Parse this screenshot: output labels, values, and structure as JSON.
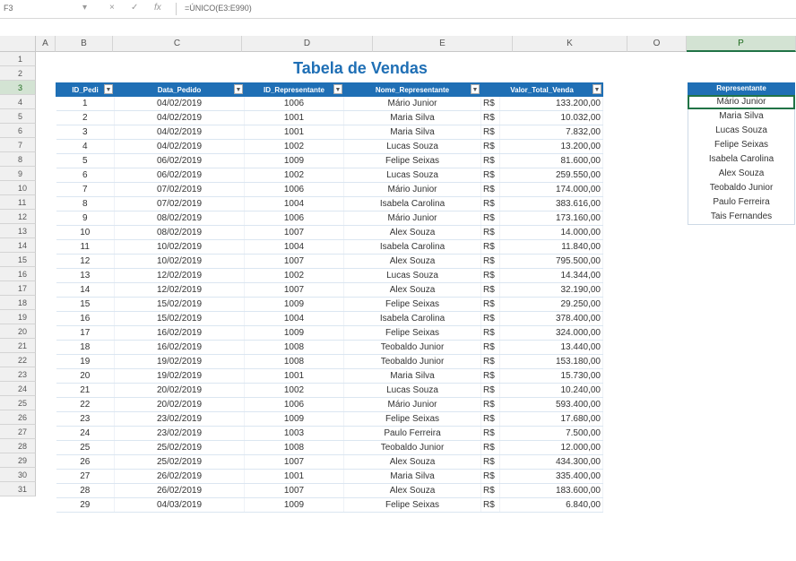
{
  "formula_bar": {
    "name_box": "F3",
    "fx": "fx",
    "formula": "=ÚNICO(E3:E990)"
  },
  "columns": [
    "A",
    "B",
    "C",
    "D",
    "E",
    "K",
    "O",
    "P"
  ],
  "rows": [
    "1",
    "2",
    "3",
    "4",
    "5",
    "6",
    "7",
    "8",
    "9",
    "10",
    "11",
    "12",
    "13",
    "14",
    "15",
    "16",
    "17",
    "18",
    "19",
    "20",
    "21",
    "22",
    "23",
    "24",
    "25",
    "26",
    "27",
    "28",
    "29",
    "30",
    "31"
  ],
  "title": "Tabela de Vendas",
  "table": {
    "headers": [
      "ID_Pedi",
      "Data_Pedido",
      "ID_Representante",
      "Nome_Representante",
      "Valor_Total_Venda"
    ],
    "currency": "R$",
    "rows": [
      [
        "1",
        "04/02/2019",
        "1006",
        "Mário Junior",
        "133.200,00"
      ],
      [
        "2",
        "04/02/2019",
        "1001",
        "Maria Silva",
        "10.032,00"
      ],
      [
        "3",
        "04/02/2019",
        "1001",
        "Maria Silva",
        "7.832,00"
      ],
      [
        "4",
        "04/02/2019",
        "1002",
        "Lucas Souza",
        "13.200,00"
      ],
      [
        "5",
        "06/02/2019",
        "1009",
        "Felipe Seixas",
        "81.600,00"
      ],
      [
        "6",
        "06/02/2019",
        "1002",
        "Lucas Souza",
        "259.550,00"
      ],
      [
        "7",
        "07/02/2019",
        "1006",
        "Mário Junior",
        "174.000,00"
      ],
      [
        "8",
        "07/02/2019",
        "1004",
        "Isabela Carolina",
        "383.616,00"
      ],
      [
        "9",
        "08/02/2019",
        "1006",
        "Mário Junior",
        "173.160,00"
      ],
      [
        "10",
        "08/02/2019",
        "1007",
        "Alex Souza",
        "14.000,00"
      ],
      [
        "11",
        "10/02/2019",
        "1004",
        "Isabela Carolina",
        "11.840,00"
      ],
      [
        "12",
        "10/02/2019",
        "1007",
        "Alex Souza",
        "795.500,00"
      ],
      [
        "13",
        "12/02/2019",
        "1002",
        "Lucas Souza",
        "14.344,00"
      ],
      [
        "14",
        "12/02/2019",
        "1007",
        "Alex Souza",
        "32.190,00"
      ],
      [
        "15",
        "15/02/2019",
        "1009",
        "Felipe Seixas",
        "29.250,00"
      ],
      [
        "16",
        "15/02/2019",
        "1004",
        "Isabela Carolina",
        "378.400,00"
      ],
      [
        "17",
        "16/02/2019",
        "1009",
        "Felipe Seixas",
        "324.000,00"
      ],
      [
        "18",
        "16/02/2019",
        "1008",
        "Teobaldo Junior",
        "13.440,00"
      ],
      [
        "19",
        "19/02/2019",
        "1008",
        "Teobaldo Junior",
        "153.180,00"
      ],
      [
        "20",
        "19/02/2019",
        "1001",
        "Maria Silva",
        "15.730,00"
      ],
      [
        "21",
        "20/02/2019",
        "1002",
        "Lucas Souza",
        "10.240,00"
      ],
      [
        "22",
        "20/02/2019",
        "1006",
        "Mário Junior",
        "593.400,00"
      ],
      [
        "23",
        "23/02/2019",
        "1009",
        "Felipe Seixas",
        "17.680,00"
      ],
      [
        "24",
        "23/02/2019",
        "1003",
        "Paulo Ferreira",
        "7.500,00"
      ],
      [
        "25",
        "25/02/2019",
        "1008",
        "Teobaldo Junior",
        "12.000,00"
      ],
      [
        "26",
        "25/02/2019",
        "1007",
        "Alex Souza",
        "434.300,00"
      ],
      [
        "27",
        "26/02/2019",
        "1001",
        "Maria Silva",
        "335.400,00"
      ],
      [
        "28",
        "26/02/2019",
        "1007",
        "Alex Souza",
        "183.600,00"
      ],
      [
        "29",
        "04/03/2019",
        "1009",
        "Felipe Seixas",
        "6.840,00"
      ]
    ]
  },
  "representantes": {
    "header": "Representante",
    "items": [
      "Mário Junior",
      "Maria Silva",
      "Lucas Souza",
      "Felipe Seixas",
      "Isabela Carolina",
      "Alex Souza",
      "Teobaldo Junior",
      "Paulo Ferreira",
      "Tais Fernandes"
    ]
  },
  "colors": {
    "header_blue": "#1f6fb5",
    "title_blue": "#1f6fb5",
    "excel_green": "#217346"
  }
}
